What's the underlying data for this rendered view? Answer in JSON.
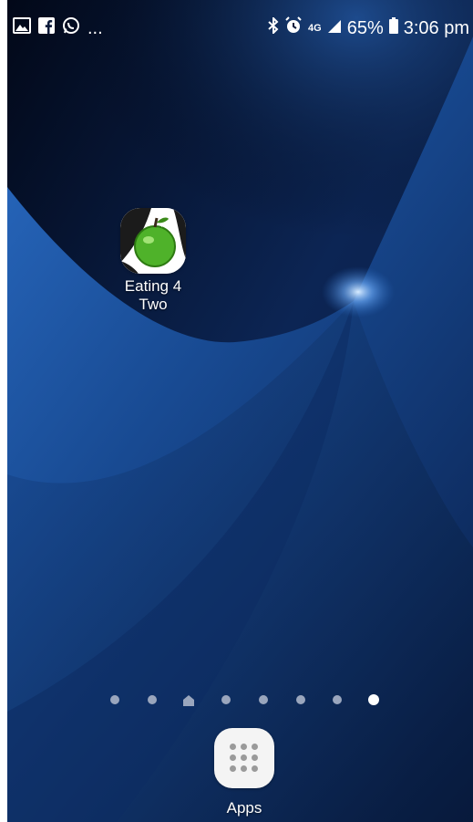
{
  "status_bar": {
    "left_icons": [
      "gallery-icon",
      "facebook-icon",
      "whatsapp-icon"
    ],
    "overflow": "...",
    "network": "4G",
    "battery_percent": "65%",
    "time": "3:06 pm"
  },
  "home": {
    "app_shortcut": {
      "label_line1": "Eating 4",
      "label_line2": "Two",
      "icon": "green-apple-icon"
    },
    "page_count": 8,
    "home_page_index": 2,
    "active_page_index": 7,
    "apps_button": {
      "label": "Apps"
    }
  },
  "colors": {
    "wallpaper_dark": "#050f2a",
    "wallpaper_blue": "#1e5aa8",
    "dot_inactive": "#9aa6bd",
    "dot_active": "#ffffff"
  }
}
